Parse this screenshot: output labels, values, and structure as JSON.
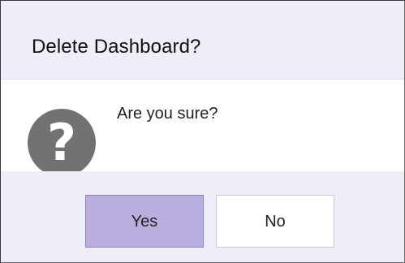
{
  "dialog": {
    "title": "Delete Dashboard?",
    "message": "Are you sure?",
    "icon": "question-icon",
    "icon_glyph": "?",
    "buttons": {
      "yes_label": "Yes",
      "no_label": "No"
    },
    "colors": {
      "header_background": "#eeeef9",
      "footer_background": "#eeeef9",
      "primary_button": "#b9aede",
      "icon_background": "#727272"
    }
  }
}
